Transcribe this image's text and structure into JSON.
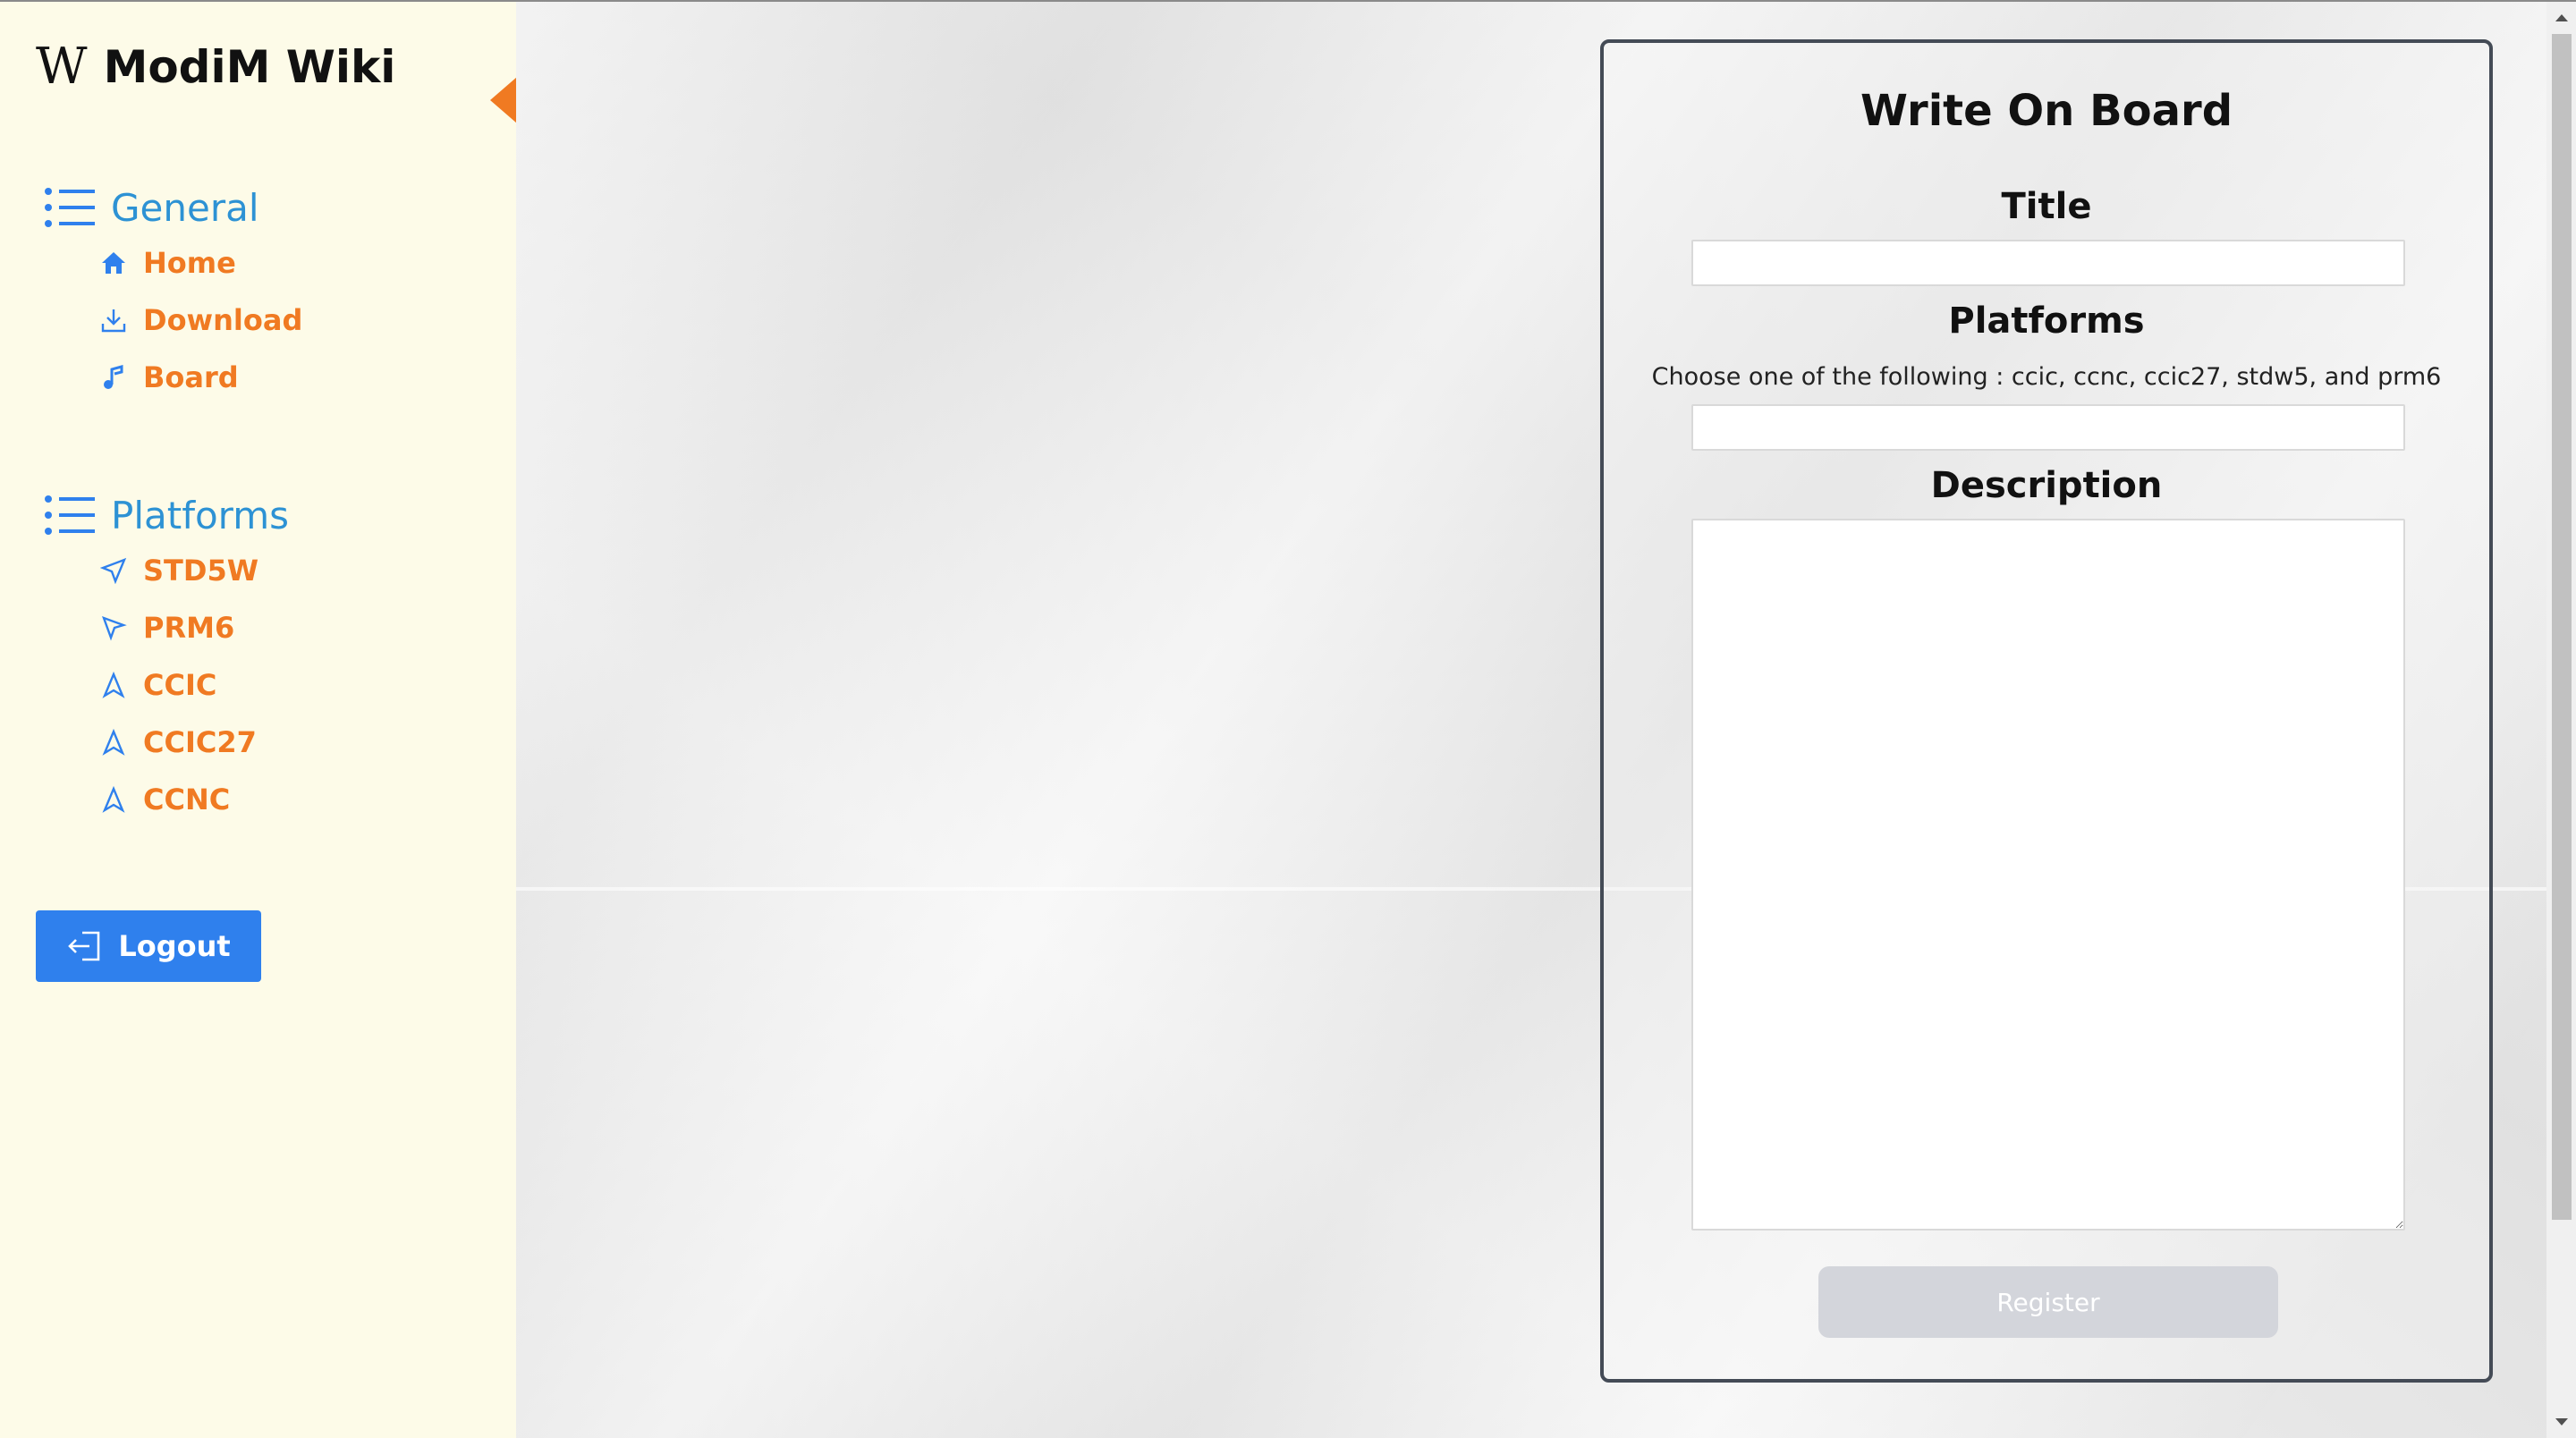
{
  "brand": {
    "logo": "W",
    "title": "ModiM Wiki"
  },
  "colors": {
    "accent_orange": "#f07a22",
    "section_blue": "#2d92d4",
    "icon_blue": "#2f80ed",
    "button_blue": "#2f80ed",
    "sidebar_bg": "#fdfbe8"
  },
  "sidebar": {
    "sections": [
      {
        "label": "General",
        "icon": "list-icon",
        "items": [
          {
            "label": "Home",
            "icon": "home-icon"
          },
          {
            "label": "Download",
            "icon": "download-icon"
          },
          {
            "label": "Board",
            "icon": "music-note-icon"
          }
        ]
      },
      {
        "label": "Platforms",
        "icon": "list-icon",
        "items": [
          {
            "label": "STD5W",
            "icon": "send-icon"
          },
          {
            "label": "PRM6",
            "icon": "cursor-icon"
          },
          {
            "label": "CCIC",
            "icon": "navigation-icon"
          },
          {
            "label": "CCIC27",
            "icon": "navigation-icon"
          },
          {
            "label": "CCNC",
            "icon": "navigation-icon"
          }
        ]
      }
    ],
    "logout_label": "Logout"
  },
  "form": {
    "heading": "Write On Board",
    "title_label": "Title",
    "title_value": "",
    "platforms_label": "Platforms",
    "platforms_hint": "Choose one of the following : ccic, ccnc, ccic27, stdw5, and prm6",
    "platforms_value": "",
    "description_label": "Description",
    "description_value": "",
    "register_label": "Register"
  }
}
